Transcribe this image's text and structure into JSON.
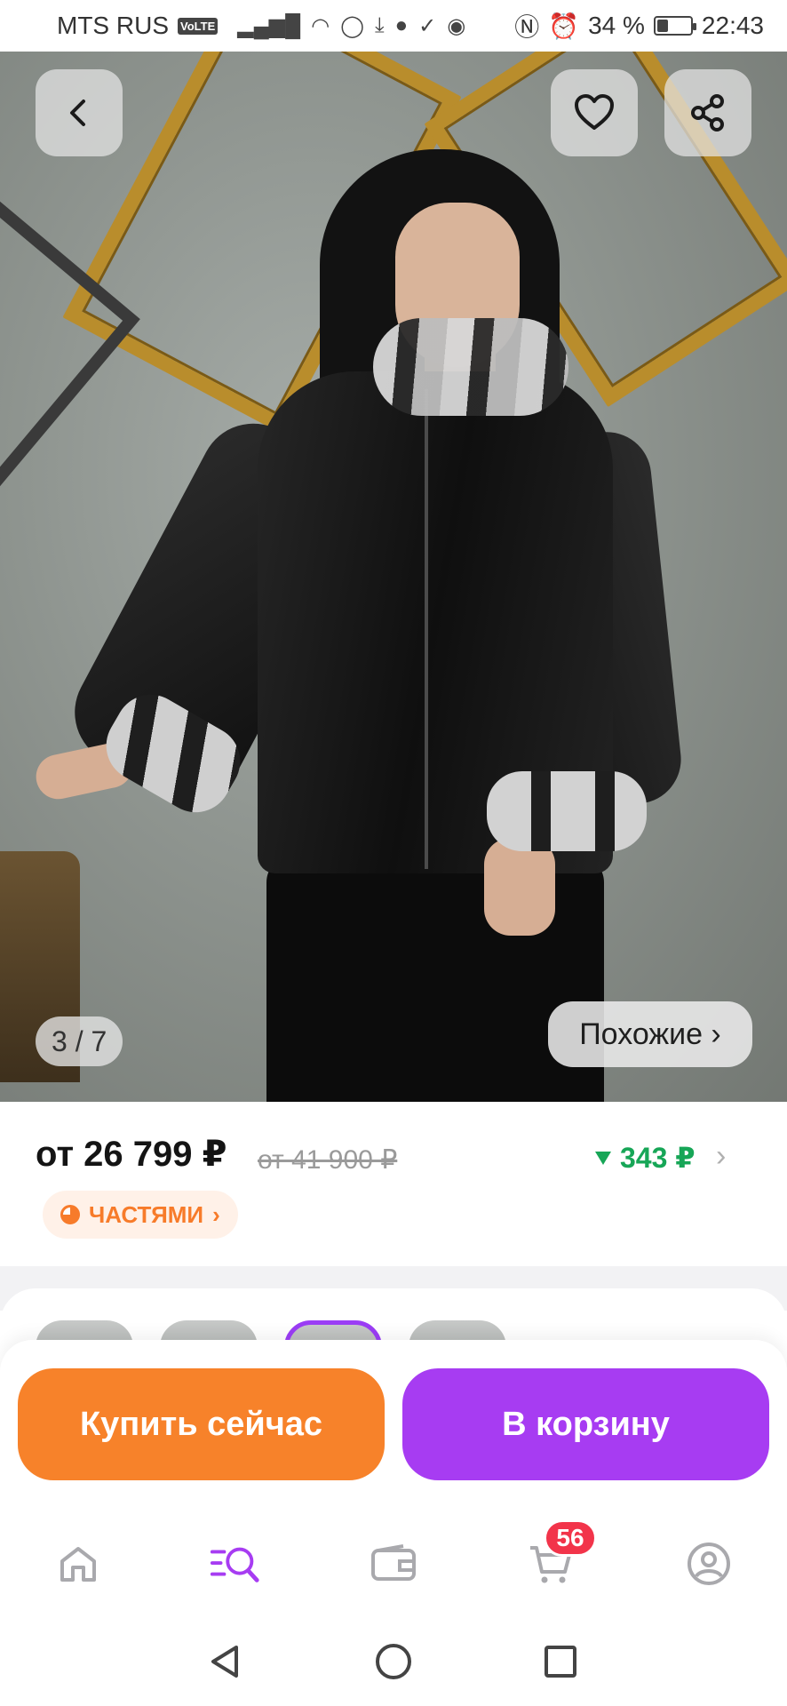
{
  "status_bar": {
    "carrier": "MTS RUS",
    "volte": "VoLTE",
    "battery_text": "34 %",
    "battery_level": 0.34,
    "time": "22:43",
    "icons": [
      "signal-icon",
      "wifi-icon",
      "whatsapp-icon",
      "download-icon",
      "chat-icon",
      "check-circle-icon",
      "message-icon",
      "nfc-icon",
      "alarm-icon",
      "battery-icon"
    ]
  },
  "gallery": {
    "counter": "3 / 7",
    "current_index": 3,
    "total": 7,
    "similar_label": "Похожие ›"
  },
  "product": {
    "price": "от 26 799 ₽",
    "old_price": "от 41 900 ₽",
    "cashback": "343 ₽",
    "parts_label": "ЧАСТЯМИ"
  },
  "actions": {
    "buy_now": "Купить сейчас",
    "add_to_cart": "В корзину"
  },
  "bottom_nav": {
    "items": [
      "home-icon",
      "catalog-search-icon",
      "wallet-icon",
      "cart-icon",
      "profile-icon"
    ],
    "active": "catalog-search-icon",
    "cart_badge": "56"
  },
  "colors": {
    "accent_orange": "#f7822a",
    "accent_purple": "#a73cf2",
    "cashback_green": "#17a657",
    "badge_red": "#f2344a"
  }
}
